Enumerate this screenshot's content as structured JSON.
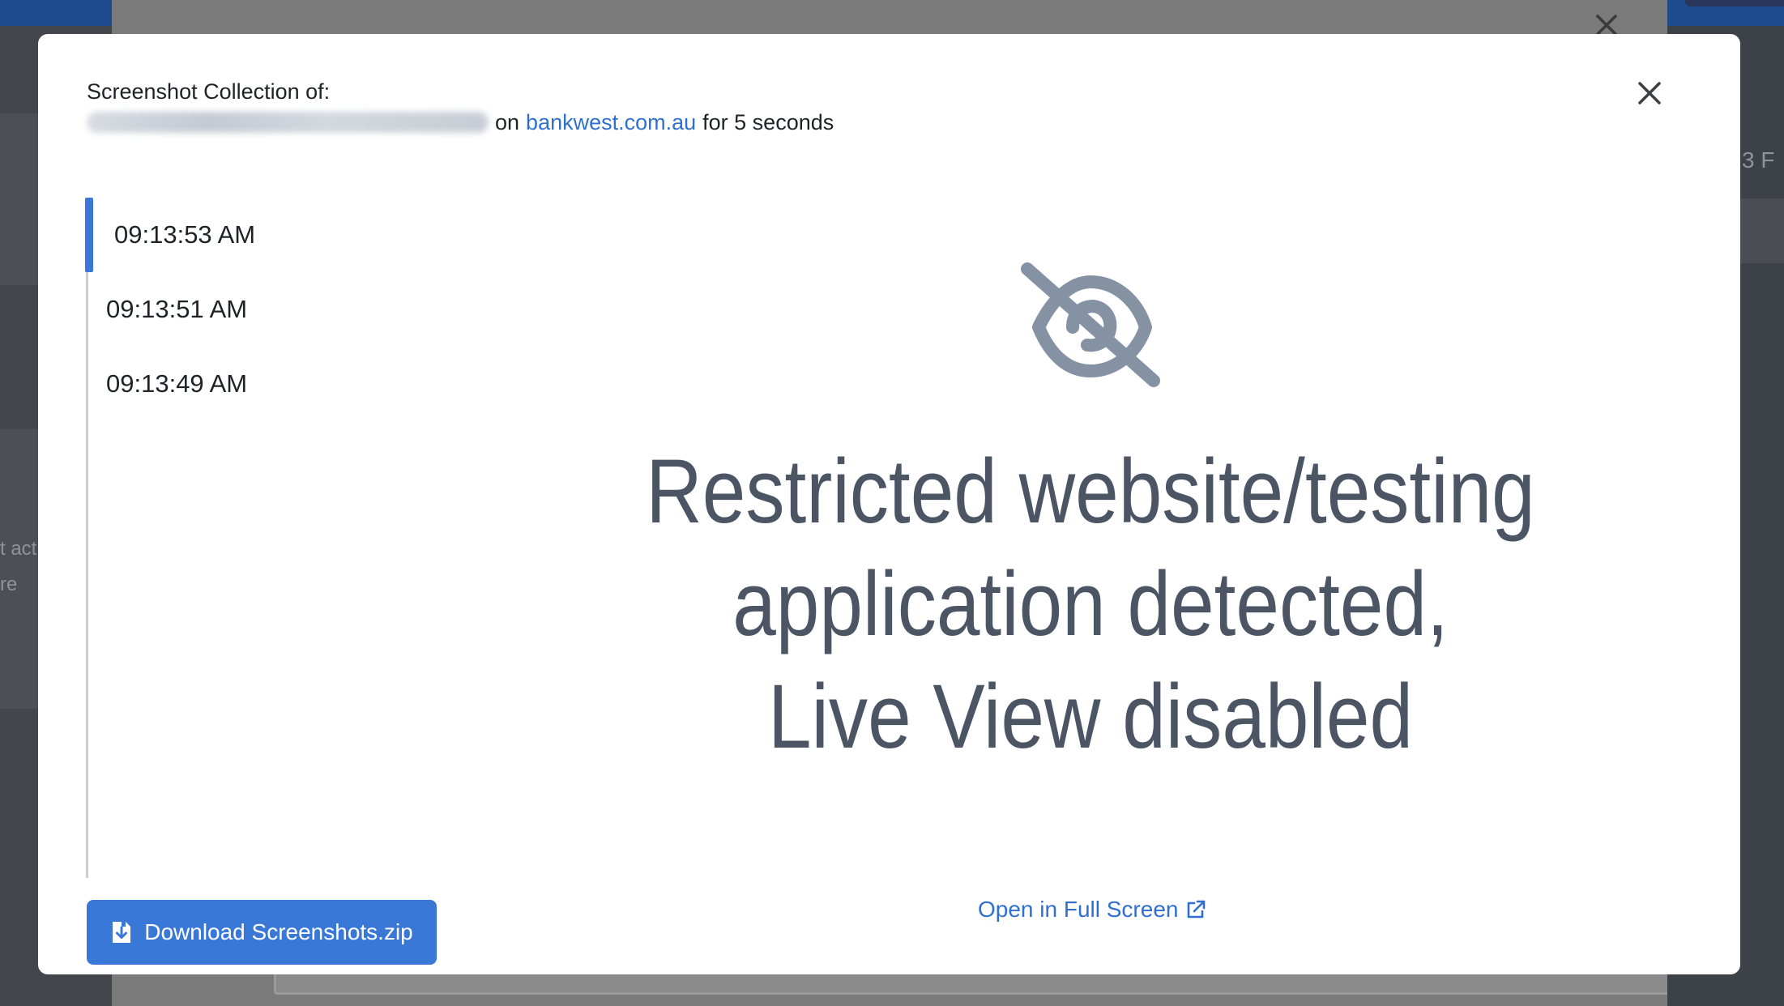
{
  "background": {
    "left_text_lines": [
      "t act",
      "re"
    ],
    "right_text": "3 F"
  },
  "modal": {
    "header": {
      "title": "Screenshot Collection of:",
      "on_text": "on",
      "site_link": "bankwest.com.au",
      "duration_text": "for 5 seconds"
    },
    "timeline": {
      "items": [
        {
          "time": "09:13:53 AM",
          "active": true
        },
        {
          "time": "09:13:51 AM",
          "active": false
        },
        {
          "time": "09:13:49 AM",
          "active": false
        }
      ]
    },
    "viewer": {
      "icon": "eye-slash-icon",
      "message_lines": [
        "Restricted website/testing",
        "application detected,",
        "Live View disabled"
      ],
      "fullscreen_label": "Open in Full Screen",
      "fullscreen_icon": "external-link-icon"
    },
    "download": {
      "label": "Download Screenshots.zip",
      "icon": "file-download-icon"
    }
  },
  "colors": {
    "accent": "#3a78d8",
    "link": "#2f6fcf",
    "message_text": "#4b5563",
    "icon_gray": "#8592a3",
    "timeline_rule": "#c9ced4"
  }
}
